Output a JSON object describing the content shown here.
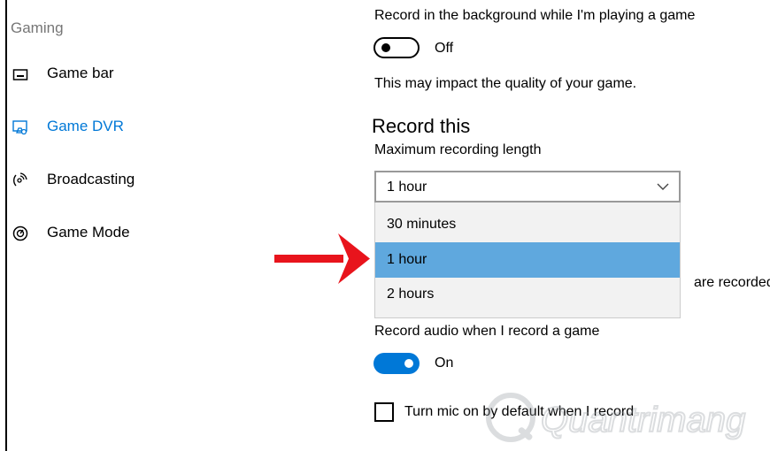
{
  "sidebar": {
    "heading": "Gaming",
    "items": [
      {
        "label": "Game bar",
        "icon": "game-bar-icon"
      },
      {
        "label": "Game DVR",
        "icon": "game-dvr-icon",
        "active": true
      },
      {
        "label": "Broadcasting",
        "icon": "broadcasting-icon"
      },
      {
        "label": "Game Mode",
        "icon": "game-mode-icon"
      }
    ]
  },
  "background_recording": {
    "label": "Record in the background while I'm playing a game",
    "toggle_state": "Off",
    "note": "This may impact the quality of your game."
  },
  "record_this": {
    "title": "Record this",
    "max_length_label": "Maximum recording length",
    "max_length_value": "1 hour",
    "options": [
      "30 minutes",
      "1 hour",
      "2 hours"
    ],
    "selected_index": 1,
    "obscured_text": "are recorded"
  },
  "audio": {
    "label": "Record audio when I record a game",
    "toggle_state": "On"
  },
  "mic": {
    "label": "Turn mic on by default when I record",
    "checked": false
  },
  "watermark": {
    "text": "Quantrimang"
  },
  "colors": {
    "accent": "#0078d7",
    "selected_option": "#5fa8de",
    "arrow": "#e8141c"
  }
}
